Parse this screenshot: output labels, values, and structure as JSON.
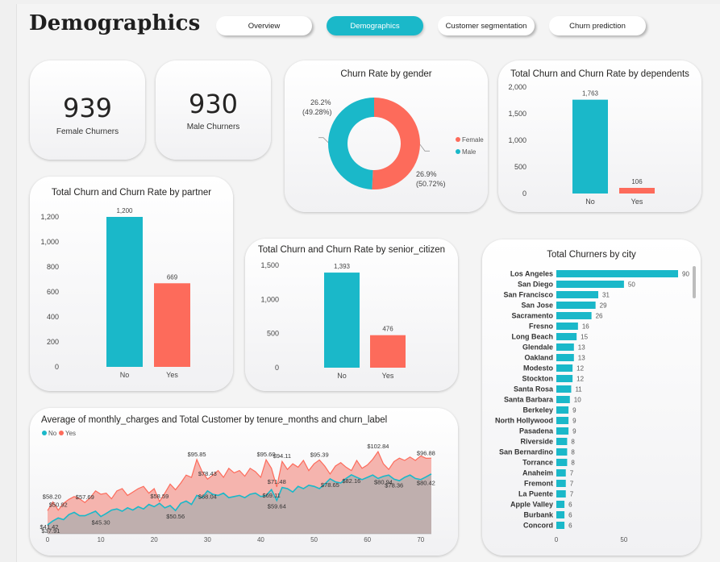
{
  "header": {
    "title": "Demographics",
    "nav": [
      {
        "label": "Overview",
        "active": false
      },
      {
        "label": "Demographics",
        "active": true
      },
      {
        "label": "Customer segmentation",
        "active": false
      },
      {
        "label": "Churn prediction",
        "active": false
      }
    ]
  },
  "colors": {
    "accent": "#1ab8c9",
    "female": "#fd6b5b",
    "male": "#1ab8c9",
    "area_yes": "#f5b4ae",
    "area_no": "#b9aeae"
  },
  "kpis": {
    "female": {
      "value": "939",
      "label": "Female Churners"
    },
    "male": {
      "value": "930",
      "label": "Male Churners"
    }
  },
  "chart_data": [
    {
      "id": "gender",
      "type": "pie",
      "title": "Churn Rate by gender",
      "slices": [
        {
          "name": "Female",
          "value": 50.72,
          "label": "26.9%",
          "sublabel": "(50.72%)",
          "color": "#fd6b5b"
        },
        {
          "name": "Male",
          "value": 49.28,
          "label": "26.2%",
          "sublabel": "(49.28%)",
          "color": "#1ab8c9"
        }
      ],
      "legend": [
        "Female",
        "Male"
      ]
    },
    {
      "id": "dependents",
      "type": "bar",
      "title": "Total Churn and Churn Rate by dependents",
      "categories": [
        "No",
        "Yes"
      ],
      "values": [
        1763,
        106
      ],
      "value_labels": [
        "1,763",
        "106"
      ],
      "colors": [
        "#1ab8c9",
        "#fd6b5b"
      ],
      "ylim": [
        0,
        2000
      ],
      "yticks": [
        0,
        500,
        1000,
        1500,
        2000
      ],
      "ytick_labels": [
        "0",
        "500",
        "1,000",
        "1,500",
        "2,000"
      ]
    },
    {
      "id": "partner",
      "type": "bar",
      "title": "Total Churn and Churn Rate by partner",
      "categories": [
        "No",
        "Yes"
      ],
      "values": [
        1200,
        669
      ],
      "value_labels": [
        "1,200",
        "669"
      ],
      "colors": [
        "#1ab8c9",
        "#fd6b5b"
      ],
      "ylim": [
        0,
        1200
      ],
      "yticks": [
        0,
        200,
        400,
        600,
        800,
        1000,
        1200
      ],
      "ytick_labels": [
        "0",
        "200",
        "400",
        "600",
        "800",
        "1,000",
        "1,200"
      ]
    },
    {
      "id": "senior",
      "type": "bar",
      "title": "Total Churn and Churn Rate by senior_citizen",
      "categories": [
        "No",
        "Yes"
      ],
      "values": [
        1393,
        476
      ],
      "value_labels": [
        "1,393",
        "476"
      ],
      "colors": [
        "#1ab8c9",
        "#fd6b5b"
      ],
      "ylim": [
        0,
        1500
      ],
      "yticks": [
        0,
        500,
        1000,
        1500
      ],
      "ytick_labels": [
        "0",
        "500",
        "1,000",
        "1,500"
      ]
    },
    {
      "id": "city",
      "type": "bar",
      "orientation": "horizontal",
      "title": "Total Churners by city",
      "categories": [
        "Los Angeles",
        "San Diego",
        "San Francisco",
        "San Jose",
        "Sacramento",
        "Fresno",
        "Long Beach",
        "Glendale",
        "Oakland",
        "Modesto",
        "Stockton",
        "Santa Rosa",
        "Santa Barbara",
        "Berkeley",
        "North Hollywood",
        "Pasadena",
        "Riverside",
        "San Bernardino",
        "Torrance",
        "Anaheim",
        "Fremont",
        "La Puente",
        "Apple Valley",
        "Burbank",
        "Concord"
      ],
      "values": [
        90,
        50,
        31,
        29,
        26,
        16,
        15,
        13,
        13,
        12,
        12,
        11,
        10,
        9,
        9,
        9,
        8,
        8,
        8,
        7,
        7,
        7,
        6,
        6,
        6
      ],
      "color": "#1ab8c9",
      "xlim": [
        0,
        90
      ],
      "xticks": [
        0,
        50
      ],
      "xtick_labels": [
        "0",
        "50"
      ]
    },
    {
      "id": "tenure",
      "type": "area",
      "title": "Average of monthly_charges and Total Customer by tenure_months and churn_label",
      "legend": [
        "No",
        "Yes"
      ],
      "xlim": [
        0,
        72
      ],
      "ylim": [
        30,
        110
      ],
      "xticks": [
        0,
        10,
        20,
        30,
        40,
        50,
        60,
        70
      ],
      "xtick_labels": [
        "0",
        "10",
        "20",
        "30",
        "40",
        "50",
        "60",
        "70"
      ],
      "x": [
        0,
        1,
        2,
        3,
        4,
        5,
        6,
        7,
        8,
        9,
        10,
        11,
        12,
        13,
        14,
        15,
        16,
        17,
        18,
        19,
        20,
        21,
        22,
        23,
        24,
        25,
        26,
        27,
        28,
        29,
        30,
        31,
        32,
        33,
        34,
        35,
        36,
        37,
        38,
        39,
        40,
        41,
        42,
        43,
        44,
        45,
        46,
        47,
        48,
        49,
        50,
        51,
        52,
        53,
        54,
        55,
        56,
        57,
        58,
        59,
        60,
        61,
        62,
        63,
        64,
        65,
        66,
        67,
        68,
        69,
        70,
        71,
        72
      ],
      "series": [
        {
          "name": "Yes",
          "color": "#fd6b5b",
          "values": [
            50.5,
            58.2,
            50.9,
            57.0,
            60.5,
            63.0,
            61.0,
            57.7,
            62.0,
            68.0,
            65.0,
            66.0,
            61.0,
            68.0,
            70.0,
            64.0,
            67.0,
            70.0,
            72.0,
            66.0,
            70.0,
            58.6,
            66.0,
            74.0,
            69.0,
            75.0,
            82.0,
            80.0,
            95.8,
            85.0,
            78.4,
            82.0,
            86.0,
            80.0,
            88.0,
            84.0,
            86.0,
            81.0,
            88.0,
            85.0,
            80.0,
            95.6,
            88.0,
            71.5,
            94.1,
            87.0,
            92.0,
            89.0,
            95.0,
            86.0,
            92.0,
            95.4,
            90.0,
            83.0,
            90.0,
            93.0,
            89.0,
            86.0,
            95.0,
            88.0,
            91.0,
            96.0,
            102.8,
            92.0,
            87.0,
            94.0,
            97.0,
            95.0,
            98.0,
            95.0,
            99.0,
            96.9,
            97.0
          ]
        },
        {
          "name": "No",
          "color": "#1ab8c9",
          "values": [
            37.9,
            41.4,
            44.0,
            42.5,
            47.0,
            49.0,
            46.0,
            46.0,
            48.0,
            50.0,
            45.3,
            48.0,
            51.0,
            52.0,
            50.0,
            53.0,
            51.0,
            54.0,
            52.0,
            56.0,
            54.0,
            57.0,
            53.0,
            55.0,
            50.6,
            57.0,
            59.0,
            56.0,
            64.0,
            62.0,
            68.0,
            65.0,
            64.0,
            66.0,
            62.0,
            63.0,
            64.0,
            62.0,
            65.0,
            66.0,
            63.0,
            64.0,
            69.1,
            59.6,
            71.0,
            70.0,
            67.0,
            72.0,
            70.0,
            73.0,
            72.0,
            70.0,
            74.0,
            78.7,
            76.0,
            75.0,
            79.0,
            82.2,
            80.0,
            78.0,
            80.0,
            82.0,
            79.0,
            80.9,
            82.0,
            78.4,
            77.0,
            80.0,
            82.0,
            79.0,
            78.0,
            80.4,
            83.0
          ]
        }
      ],
      "annotations": [
        {
          "x": 0.6,
          "y": 37.91,
          "label": "$37.91",
          "series": "No"
        },
        {
          "x": 0.3,
          "y": 41.42,
          "label": "$41.42",
          "series": "No"
        },
        {
          "x": 0.8,
          "y": 58.2,
          "label": "$58.20",
          "series": "Yes"
        },
        {
          "x": 2,
          "y": 50.92,
          "label": "$50.92",
          "series": "Yes"
        },
        {
          "x": 7,
          "y": 57.69,
          "label": "$57.69",
          "series": "Yes"
        },
        {
          "x": 10,
          "y": 45.3,
          "label": "$45.30",
          "series": "No"
        },
        {
          "x": 21,
          "y": 58.59,
          "label": "$58.59",
          "series": "Yes"
        },
        {
          "x": 24,
          "y": 50.56,
          "label": "$50.56",
          "series": "No"
        },
        {
          "x": 28,
          "y": 95.85,
          "label": "$95.85",
          "series": "Yes"
        },
        {
          "x": 30,
          "y": 78.43,
          "label": "$78.43",
          "series": "Yes"
        },
        {
          "x": 30,
          "y": 68.04,
          "label": "$68.04",
          "series": "No"
        },
        {
          "x": 41,
          "y": 95.6,
          "label": "$95.60",
          "series": "Yes"
        },
        {
          "x": 43,
          "y": 71.48,
          "label": "$71.48",
          "series": "Yes"
        },
        {
          "x": 42,
          "y": 69.11,
          "label": "$69.11",
          "series": "No"
        },
        {
          "x": 43,
          "y": 59.64,
          "label": "$59.64",
          "series": "No"
        },
        {
          "x": 44,
          "y": 94.11,
          "label": "$94.11",
          "series": "Yes"
        },
        {
          "x": 51,
          "y": 95.39,
          "label": "$95.39",
          "series": "Yes"
        },
        {
          "x": 53,
          "y": 78.65,
          "label": "$78.65",
          "series": "No"
        },
        {
          "x": 57,
          "y": 82.16,
          "label": "$82.16",
          "series": "No"
        },
        {
          "x": 62,
          "y": 102.84,
          "label": "$102.84",
          "series": "Yes"
        },
        {
          "x": 63,
          "y": 80.94,
          "label": "$80.94",
          "series": "No"
        },
        {
          "x": 65,
          "y": 78.36,
          "label": "$78.36",
          "series": "No"
        },
        {
          "x": 71,
          "y": 96.88,
          "label": "$96.88",
          "series": "Yes"
        },
        {
          "x": 71,
          "y": 80.42,
          "label": "$80.42",
          "series": "No"
        }
      ]
    }
  ]
}
